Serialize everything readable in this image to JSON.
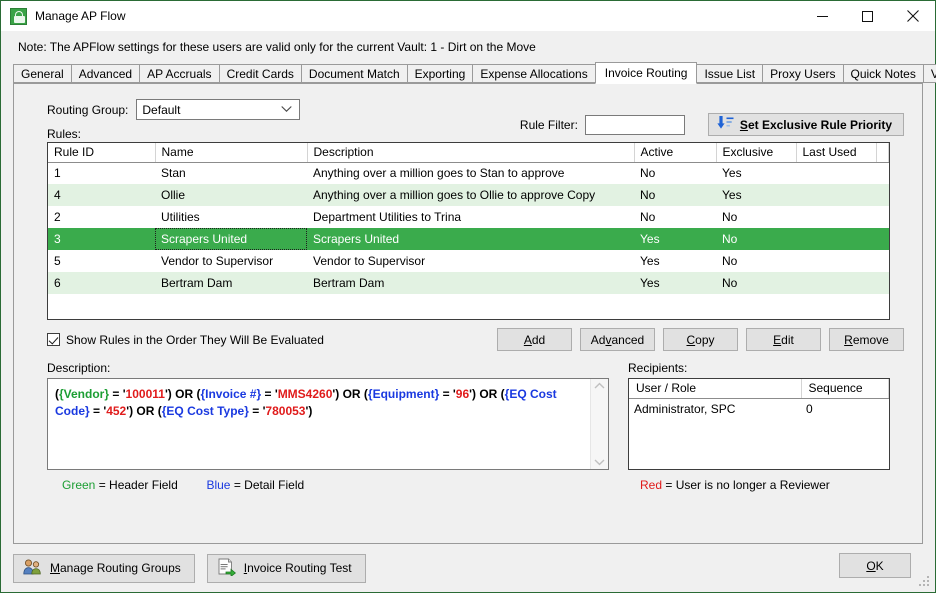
{
  "window": {
    "title": "Manage AP Flow",
    "icon": "app-lock-icon",
    "minimize_label": "Minimize",
    "maximize_label": "Maximize",
    "close_label": "Close"
  },
  "note": "Note:  The APFlow settings for these users are valid only for the current Vault: 1 - Dirt on the Move",
  "tabs": [
    {
      "label": "General",
      "active": false
    },
    {
      "label": "Advanced",
      "active": false
    },
    {
      "label": "AP Accruals",
      "active": false
    },
    {
      "label": "Credit Cards",
      "active": false
    },
    {
      "label": "Document Match",
      "active": false
    },
    {
      "label": "Exporting",
      "active": false
    },
    {
      "label": "Expense Allocations",
      "active": false
    },
    {
      "label": "Invoice Routing",
      "active": true
    },
    {
      "label": "Issue List",
      "active": false
    },
    {
      "label": "Proxy Users",
      "active": false
    },
    {
      "label": "Quick Notes",
      "active": false
    },
    {
      "label": "Validation",
      "active": false
    }
  ],
  "routing_group": {
    "label": "Routing Group:",
    "value": "Default"
  },
  "rules_label": "Rules:",
  "rule_filter": {
    "label": "Rule Filter:",
    "value": "",
    "placeholder": ""
  },
  "exclusive_button": {
    "label": "Set Exclusive Rule Priority",
    "mnemonic": "S",
    "icon": "sort-descending-icon"
  },
  "grid": {
    "columns": [
      "Rule ID",
      "Name",
      "Description",
      "Active",
      "Exclusive",
      "Last Used",
      ""
    ],
    "rows": [
      {
        "rule_id": "1",
        "name": "Stan",
        "description": "Anything over a million goes to Stan to approve",
        "active": "No",
        "exclusive": "Yes",
        "last_used": "",
        "selected": false,
        "alt": false
      },
      {
        "rule_id": "4",
        "name": "Ollie",
        "description": "Anything over a million goes to Ollie to approve Copy",
        "active": "No",
        "exclusive": "Yes",
        "last_used": "",
        "selected": false,
        "alt": true
      },
      {
        "rule_id": "2",
        "name": "Utilities",
        "description": "Department Utilities to Trina",
        "active": "No",
        "exclusive": "No",
        "last_used": "",
        "selected": false,
        "alt": false
      },
      {
        "rule_id": "3",
        "name": "Scrapers United",
        "description": "Scrapers United",
        "active": "Yes",
        "exclusive": "No",
        "last_used": "",
        "selected": true,
        "alt": false
      },
      {
        "rule_id": "5",
        "name": "Vendor to Supervisor",
        "description": "Vendor to Supervisor",
        "active": "Yes",
        "exclusive": "No",
        "last_used": "",
        "selected": false,
        "alt": false
      },
      {
        "rule_id": "6",
        "name": "Bertram Dam",
        "description": "Bertram Dam",
        "active": "Yes",
        "exclusive": "No",
        "last_used": "",
        "selected": false,
        "alt": true
      }
    ]
  },
  "show_rules_checkbox": {
    "label": "Show Rules in the Order They Will Be Evaluated",
    "checked": true
  },
  "rule_buttons": [
    {
      "label": "Add",
      "mnemonic": "A"
    },
    {
      "label": "Advanced",
      "mnemonic": "v"
    },
    {
      "label": "Copy",
      "mnemonic": "C"
    },
    {
      "label": "Edit",
      "mnemonic": "E"
    },
    {
      "label": "Remove",
      "mnemonic": "R"
    }
  ],
  "description": {
    "label": "Description:",
    "tokens": [
      {
        "t": "(",
        "k": "op"
      },
      {
        "t": "{Vendor}",
        "k": "header"
      },
      {
        "t": " = '",
        "k": "op"
      },
      {
        "t": "100011",
        "k": "value"
      },
      {
        "t": "') OR (",
        "k": "op"
      },
      {
        "t": "{Invoice #}",
        "k": "detail"
      },
      {
        "t": " = '",
        "k": "op"
      },
      {
        "t": "MMS4260",
        "k": "value"
      },
      {
        "t": "') OR (",
        "k": "op"
      },
      {
        "t": "{Equipment}",
        "k": "detail"
      },
      {
        "t": " = '",
        "k": "op"
      },
      {
        "t": "96",
        "k": "value"
      },
      {
        "t": "') OR (",
        "k": "op"
      },
      {
        "t": "{EQ Cost Code}",
        "k": "detail"
      },
      {
        "t": " = '",
        "k": "op"
      },
      {
        "t": "452",
        "k": "value"
      },
      {
        "t": "') OR (",
        "k": "op"
      },
      {
        "t": "{EQ Cost Type}",
        "k": "detail"
      },
      {
        "t": " = '",
        "k": "op"
      },
      {
        "t": "780053",
        "k": "value"
      },
      {
        "t": "')",
        "k": "op"
      }
    ],
    "plain": "({Vendor} = '100011') OR ({Invoice #} = 'MMS4260') OR ({Equipment} = '96') OR ({EQ Cost Code} = '452') OR ({EQ Cost Type} = '780053')"
  },
  "legend_left": {
    "green_word": "Green",
    "green_text": "= Header Field",
    "blue_word": "Blue",
    "blue_text": "= Detail Field"
  },
  "legend_right": {
    "red_word": "Red",
    "red_text": "= User is no longer a Reviewer"
  },
  "recipients": {
    "label": "Recipients:",
    "columns": [
      "User / Role",
      "Sequence"
    ],
    "rows": [
      {
        "user_role": "Administrator, SPC",
        "sequence": "0"
      }
    ]
  },
  "footer": {
    "manage_routing_groups": {
      "label": "Manage Routing Groups",
      "mnemonic": "M",
      "icon": "users-icon"
    },
    "invoice_routing_test": {
      "label": "Invoice Routing Test",
      "mnemonic": "I",
      "icon": "invoice-test-icon"
    },
    "ok": {
      "label": "OK",
      "mnemonic": "O"
    }
  },
  "colors": {
    "selection_green": "#3aab4c",
    "alt_row_green": "#e2f2e2",
    "header_field": "#1c9e33",
    "detail_field": "#1a39e0",
    "value_red": "#e01b1b",
    "window_border": "#2a6b35",
    "chrome": "#f0f0f0"
  }
}
